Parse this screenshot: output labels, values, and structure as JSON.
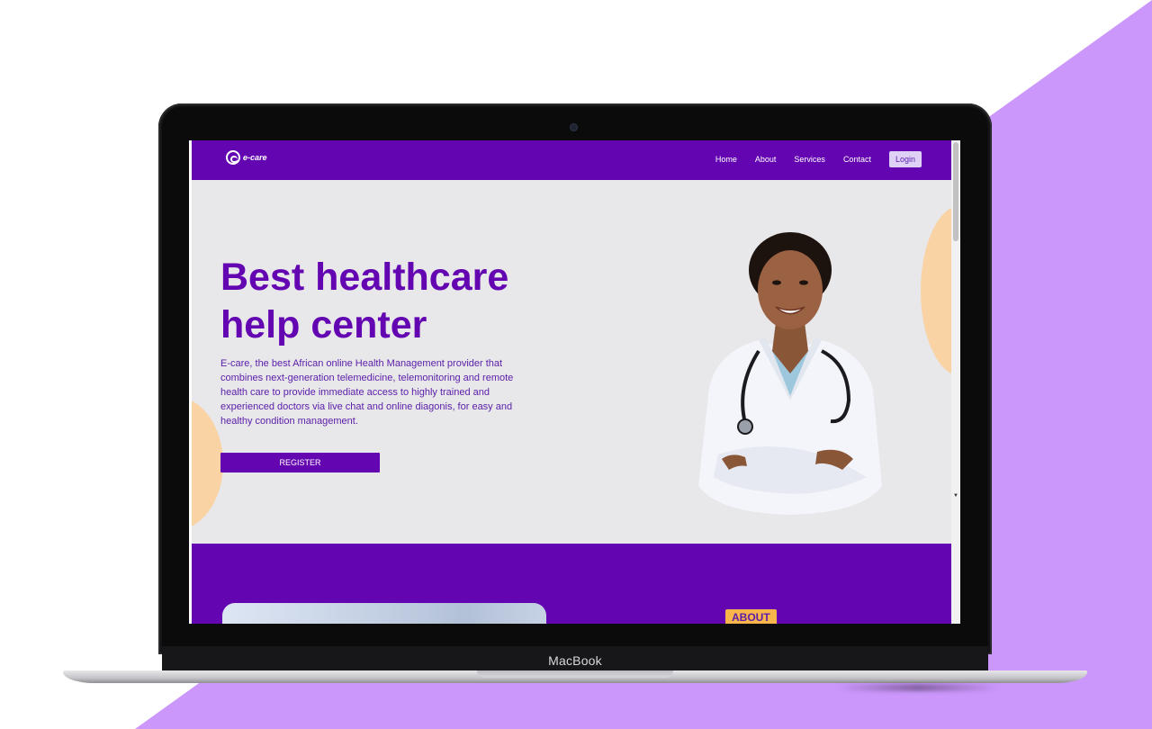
{
  "device": {
    "brand_label": "MacBook"
  },
  "site": {
    "logo_text": "e-care",
    "nav": {
      "links": [
        "Home",
        "About",
        "Services",
        "Contact"
      ],
      "login_label": "Login"
    },
    "hero": {
      "title_line1": "Best healthcare",
      "title_line2": "help center",
      "description": "E-care, the best African online Health Management provider that combines next-generation telemedicine, telemonitoring and remote health care to provide immediate access to highly trained and experienced doctors via live chat and online diagonis, for easy and healthy condition management.",
      "register_label": "REGISTER"
    },
    "about": {
      "badge": "ABOUT"
    }
  },
  "colors": {
    "brand_purple": "#6405b2",
    "hero_bg": "#e8e7ea",
    "accent_peach": "#f9d3a4",
    "badge_orange": "#f8b54b",
    "backdrop_lilac": "#cb97fb"
  }
}
